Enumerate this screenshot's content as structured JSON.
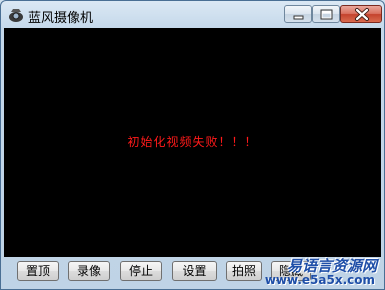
{
  "window": {
    "title": "蓝风摄像机",
    "icon": "camera-app-icon"
  },
  "title_buttons": {
    "minimize": "minimize-icon",
    "maximize": "maximize-icon",
    "close": "close-icon"
  },
  "video": {
    "status_message": "初始化视频失败！！！"
  },
  "buttons": {
    "top": "置顶",
    "record": "录像",
    "stop": "停止",
    "settings": "设置",
    "photo": "拍照",
    "hide": "隐藏"
  },
  "watermark": {
    "line1": "易语言资源网",
    "line2": "www.e5a5x.com"
  },
  "colors": {
    "status_text": "#ff1a1a",
    "video_bg": "#000000",
    "watermark": "#1f4fa8"
  }
}
